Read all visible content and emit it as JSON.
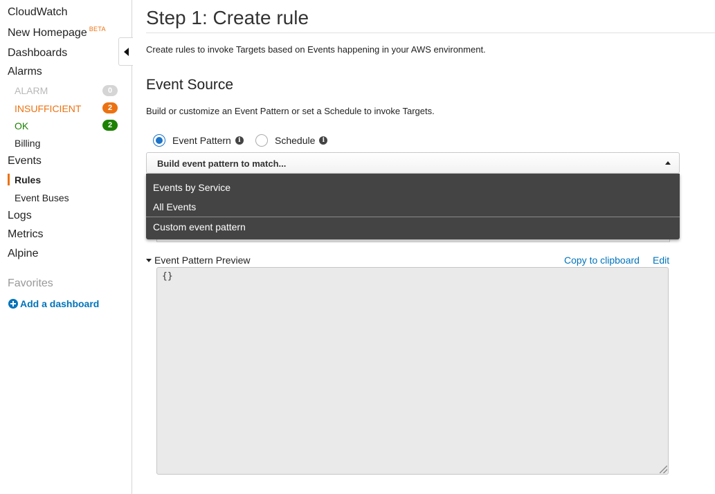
{
  "sidebar": {
    "cloudwatch": "CloudWatch",
    "new_homepage": "New Homepage",
    "beta_label": "BETA",
    "dashboards": "Dashboards",
    "alarms": "Alarms",
    "alarm_states": [
      {
        "label": "ALARM",
        "count": "0",
        "color": "#b8b8b8"
      },
      {
        "label": "INSUFFICIENT",
        "count": "2",
        "color": "#ec7211"
      },
      {
        "label": "OK",
        "count": "2",
        "color": "#1d8102"
      }
    ],
    "billing": "Billing",
    "events": "Events",
    "rules": "Rules",
    "event_buses": "Event Buses",
    "logs": "Logs",
    "metrics": "Metrics",
    "alpine": "Alpine",
    "favorites": "Favorites",
    "add_dashboard": "Add a dashboard"
  },
  "main": {
    "title": "Step 1: Create rule",
    "intro": "Create rules to invoke Targets based on Events happening in your AWS environment.",
    "section_title": "Event Source",
    "section_desc": "Build or customize an Event Pattern or set a Schedule to invoke Targets.",
    "radio_event_pattern": "Event Pattern",
    "radio_schedule": "Schedule",
    "selected_source": "Event Pattern",
    "select_label": "Build event pattern to match...",
    "dropdown_options": [
      "Events by Service",
      "All Events",
      "Custom event pattern"
    ],
    "preview_label": "Event Pattern Preview",
    "copy_link": "Copy to clipboard",
    "edit_link": "Edit",
    "preview_value": "{}"
  },
  "colors": {
    "accent_orange": "#ec7211",
    "ok_green": "#1d8102",
    "link_blue": "#0073bb",
    "dropdown_bg": "#444444"
  }
}
